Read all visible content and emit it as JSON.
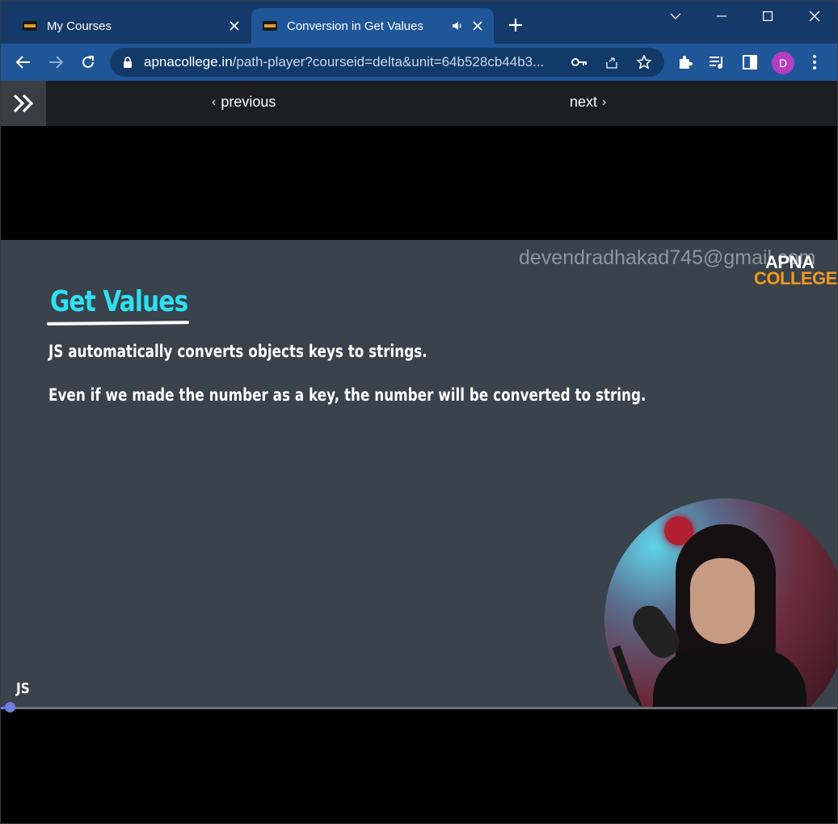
{
  "browser": {
    "tabs": [
      {
        "title": "My Courses",
        "active": false
      },
      {
        "title": "Conversion in Get Values",
        "active": true,
        "audio": true
      }
    ],
    "url_host": "apnacollege.in",
    "url_path": "/path-player?courseid=delta&unit=64b528cb44b3...",
    "profile_initial": "D",
    "colors": {
      "titlebar": "#163a6a",
      "toolbar": "#1f5698",
      "avatar": "#b43ec4"
    }
  },
  "site_nav": {
    "previous_label": "previous",
    "next_label": "next"
  },
  "slide": {
    "title": "Get Values",
    "line1": "JS automatically converts objects keys to strings.",
    "line2": "Even if we made the number as a key, the number will be converted to string.",
    "watermark": "devendradhakad745@gmail.com",
    "brand_line1": "APNA",
    "brand_line2": "COLLEGE",
    "badge": "JS",
    "colors": {
      "background": "#3a424b",
      "title": "#2ee0f0",
      "brand_accent": "#f09a1d"
    }
  },
  "player": {
    "progress_fraction": 0.01
  }
}
